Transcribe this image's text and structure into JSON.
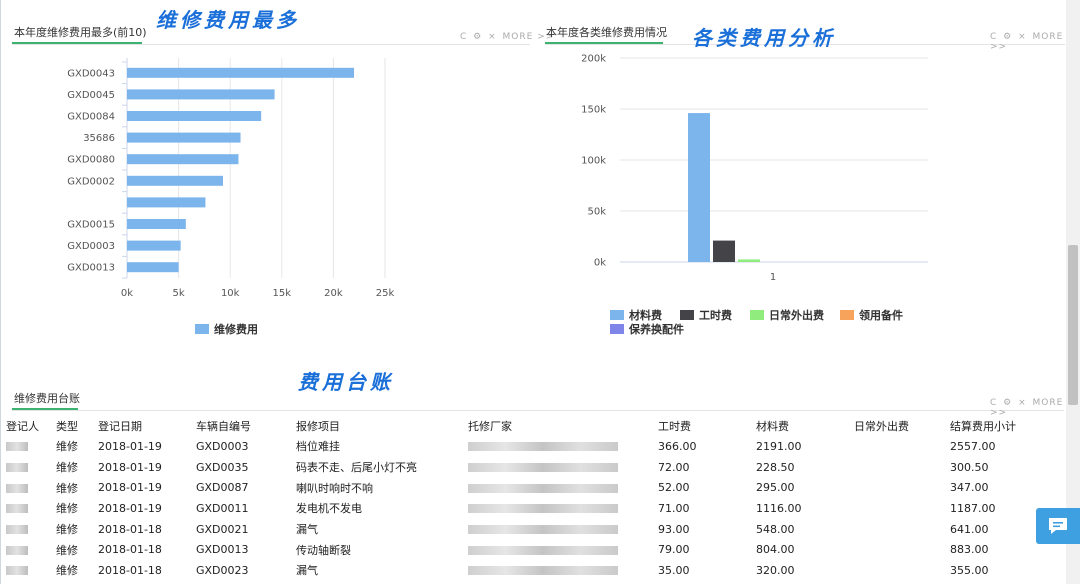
{
  "panels": {
    "top_maint": {
      "title": "本年度维修费用最多(前10)",
      "annotation": "维修费用最多",
      "tools": {
        "refresh": "C",
        "settings": "⚙",
        "close": "×",
        "more": "MORE >>"
      }
    },
    "category": {
      "title": "本年度各类维修费用情况",
      "annotation": "各类费用分析",
      "tools": {
        "refresh": "C",
        "settings": "⚙",
        "close": "×",
        "more": "MORE >>"
      }
    },
    "ledger": {
      "title": "维修费用台账",
      "annotation": "费用台账",
      "tools": {
        "refresh": "C",
        "settings": "⚙",
        "close": "×",
        "more": "MORE >>"
      }
    }
  },
  "chart_data": [
    {
      "type": "bar",
      "orientation": "horizontal",
      "categories": [
        "GXD0043",
        "GXD0045",
        "GXD0084",
        "35686",
        "GXD0080",
        "GXD0002",
        "",
        "GXD0015",
        "GXD0003",
        "GXD0013"
      ],
      "series": [
        {
          "name": "维修费用",
          "values": [
            22000,
            14300,
            13000,
            11000,
            10800,
            9300,
            7600,
            5700,
            5200,
            5000
          ],
          "color": "#7cb5ec"
        }
      ],
      "xlim": [
        0,
        25000
      ],
      "xticks": [
        "0k",
        "5k",
        "10k",
        "15k",
        "20k",
        "25k"
      ],
      "grid": true,
      "legend": "bottom"
    },
    {
      "type": "bar",
      "categories": [
        "1"
      ],
      "series": [
        {
          "name": "材料费",
          "values": [
            146000
          ],
          "color": "#7cb5ec"
        },
        {
          "name": "工时费",
          "values": [
            21000
          ],
          "color": "#434348"
        },
        {
          "name": "日常外出费",
          "values": [
            2500
          ],
          "color": "#90ed7d"
        },
        {
          "name": "领用备件",
          "values": [
            0
          ],
          "color": "#f7a35c"
        },
        {
          "name": "保养换配件",
          "values": [
            0
          ],
          "color": "#8085e9"
        }
      ],
      "ylim": [
        0,
        200000
      ],
      "yticks": [
        "0k",
        "50k",
        "100k",
        "150k",
        "200k"
      ],
      "grid": true,
      "legend": "bottom"
    }
  ],
  "ledger": {
    "headers": [
      "登记人",
      "类型",
      "登记日期",
      "车辆自编号",
      "报修项目",
      "托修厂家",
      "工时费",
      "材料费",
      "日常外出费",
      "结算费用小计"
    ],
    "rows": [
      {
        "type": "维修",
        "date": "2018-01-19",
        "vehicle": "GXD0003",
        "item": "档位难挂",
        "labor": "366.00",
        "material": "2191.00",
        "outing": "",
        "total": "2557.00"
      },
      {
        "type": "维修",
        "date": "2018-01-19",
        "vehicle": "GXD0035",
        "item": "码表不走、后尾小灯不亮",
        "labor": "72.00",
        "material": "228.50",
        "outing": "",
        "total": "300.50"
      },
      {
        "type": "维修",
        "date": "2018-01-19",
        "vehicle": "GXD0087",
        "item": "喇叭时响时不响",
        "labor": "52.00",
        "material": "295.00",
        "outing": "",
        "total": "347.00"
      },
      {
        "type": "维修",
        "date": "2018-01-19",
        "vehicle": "GXD0011",
        "item": "发电机不发电",
        "labor": "71.00",
        "material": "1116.00",
        "outing": "",
        "total": "1187.00"
      },
      {
        "type": "维修",
        "date": "2018-01-18",
        "vehicle": "GXD0021",
        "item": "漏气",
        "labor": "93.00",
        "material": "548.00",
        "outing": "",
        "total": "641.00"
      },
      {
        "type": "维修",
        "date": "2018-01-18",
        "vehicle": "GXD0013",
        "item": "传动轴断裂",
        "labor": "79.00",
        "material": "804.00",
        "outing": "",
        "total": "883.00"
      },
      {
        "type": "维修",
        "date": "2018-01-18",
        "vehicle": "GXD0023",
        "item": "漏气",
        "labor": "35.00",
        "material": "320.00",
        "outing": "",
        "total": "355.00"
      }
    ]
  },
  "icons": {
    "chat": "chat-bubble-icon"
  }
}
